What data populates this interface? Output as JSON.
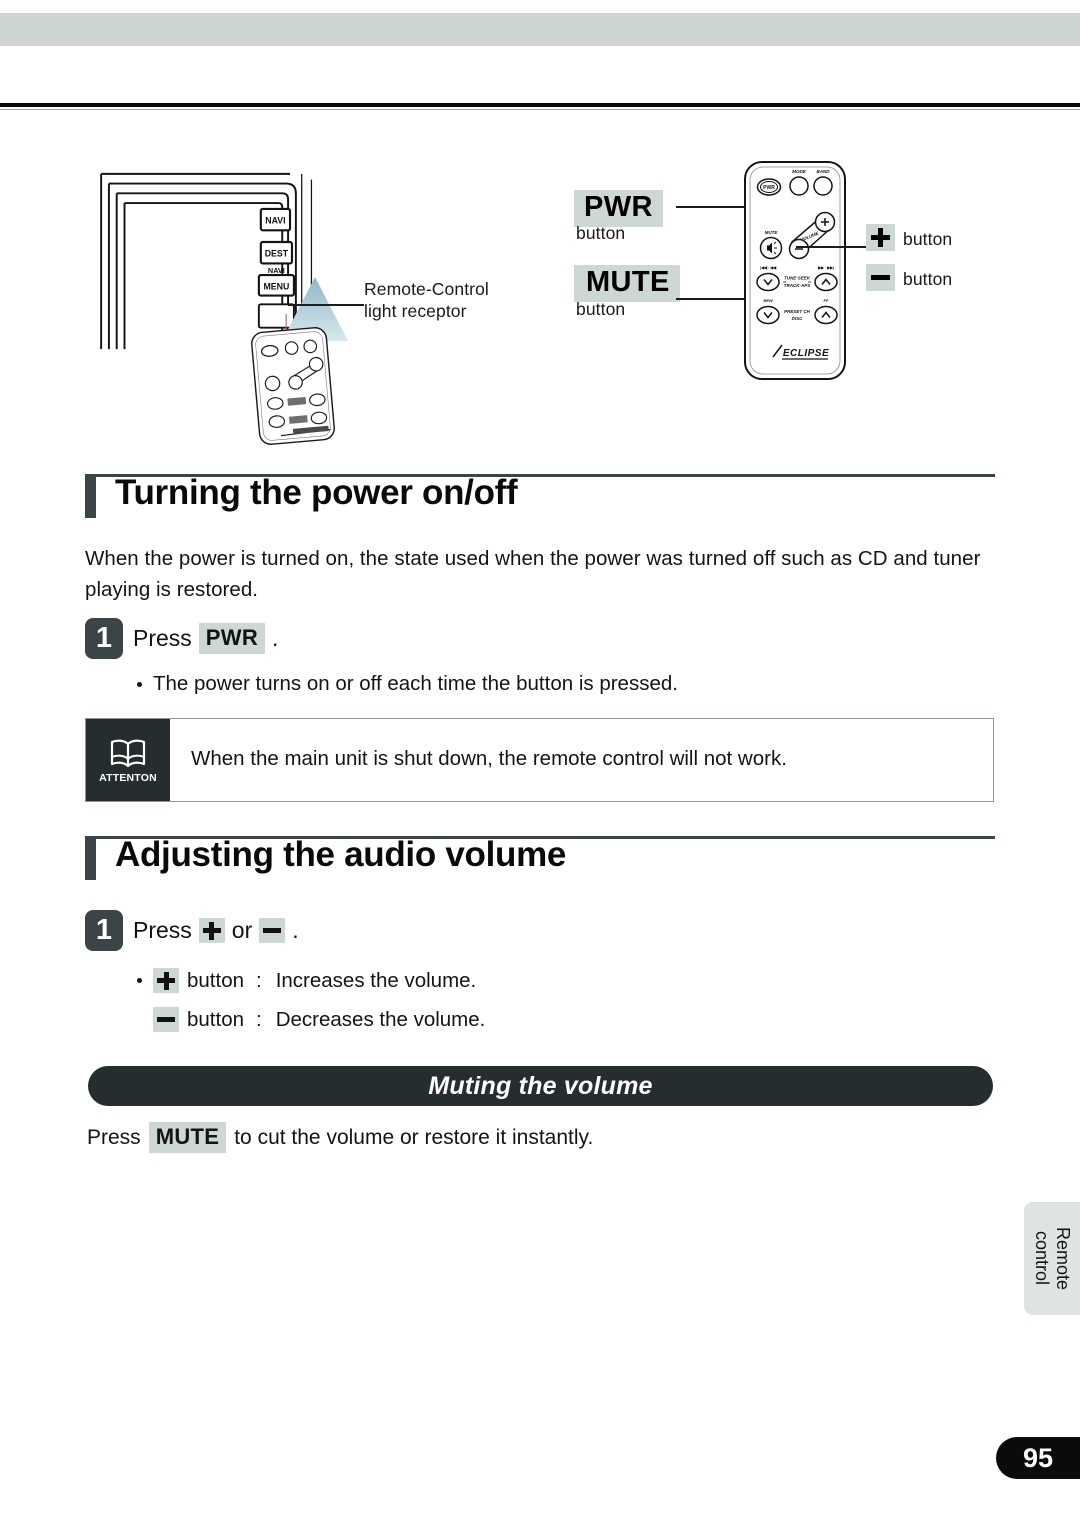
{
  "page": {
    "number": "95",
    "side_tab_label": "Remote\ncontrol",
    "side_tab_line1": "Remote",
    "side_tab_line2": "control"
  },
  "figure": {
    "receptor_label_line1": "Remote-Control",
    "receptor_label_line2": "light receptor",
    "pwr_key": "PWR",
    "pwr_sub": "button",
    "mute_key": "MUTE",
    "mute_sub": "button",
    "plus_label": "button",
    "minus_label": "button",
    "plus_icon": "plus-icon",
    "minus_icon": "minus-icon",
    "faceplate_buttons": [
      "NAVI",
      "DEST",
      "NAVI",
      "MENU"
    ],
    "remote_buttons": {
      "pwr": "PWR",
      "mode": "MODE",
      "band": "BAND",
      "mute": "MUTE",
      "volume": "VOLUME",
      "tune_seek": "TUNE-SEEK",
      "track_aps": "TRACK-APS",
      "rew": "REW",
      "ff": "FF",
      "preset_ch": "PRESET CH",
      "disc": "DISC",
      "brand": "ECLIPSE"
    }
  },
  "section_power": {
    "title": "Turning the power on/off",
    "intro": "When the power is turned on, the state used when the power was turned off such as CD and tuner playing is restored.",
    "step_number": "1",
    "step_press": "Press",
    "step_key": "PWR",
    "step_period": ".",
    "bullet": "The power turns on or off each time the button is pressed."
  },
  "note": {
    "icon_caption": "ATTENTON",
    "icon_name": "open-book-icon",
    "text": "When the main unit is shut down, the remote control will not work."
  },
  "section_volume": {
    "title": "Adjusting the audio volume",
    "step_number": "1",
    "step_press": "Press",
    "step_or": "or",
    "step_period": ".",
    "bullets": [
      {
        "icon": "plus-icon",
        "label": "button",
        "colon": ":",
        "desc": "Increases the volume."
      },
      {
        "icon": "minus-icon",
        "label": "button",
        "colon": ":",
        "desc": "Decreases the volume."
      }
    ]
  },
  "muting": {
    "pill_title": "Muting the volume",
    "press": "Press",
    "key": "MUTE",
    "rest": "to cut the volume or restore it instantly."
  },
  "colors": {
    "header_band": "#ccd5d4",
    "key_highlight": "#ccd7d6",
    "dark": "#3b4447",
    "pill": "#262d2f",
    "side_tab": "#dde4e3",
    "page_tab": "#0b0b0b"
  }
}
